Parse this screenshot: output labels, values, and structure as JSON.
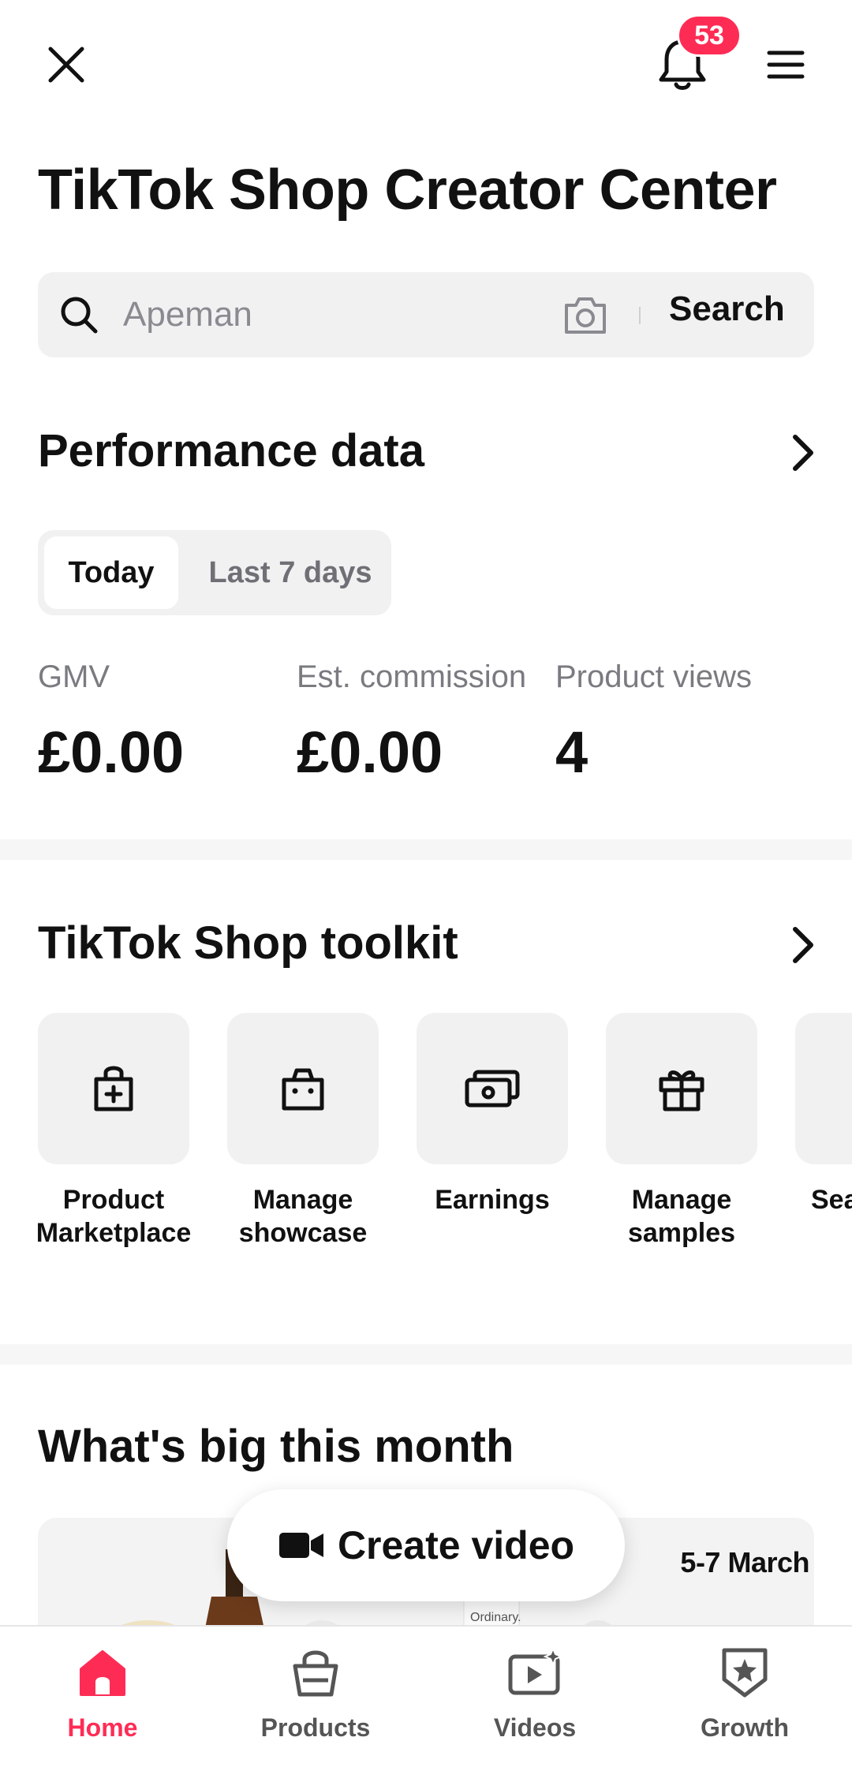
{
  "header": {
    "notification_count": "53",
    "close_icon": "close-icon",
    "bell_icon": "bell-icon",
    "menu_icon": "menu-icon"
  },
  "page_title": "TikTok Shop Creator Center",
  "search": {
    "placeholder": "Apeman",
    "value": "",
    "button_label": "Search"
  },
  "performance": {
    "title": "Performance data",
    "tabs": [
      {
        "label": "Today",
        "selected": true
      },
      {
        "label": "Last 7 days",
        "selected": false
      }
    ],
    "metrics": [
      {
        "label": "GMV",
        "value": "£0.00"
      },
      {
        "label": "Est. commission",
        "value": "£0.00"
      },
      {
        "label": "Product views",
        "value": "4"
      }
    ]
  },
  "toolkit": {
    "title": "TikTok Shop toolkit",
    "items": [
      {
        "label": "Product Marketplace",
        "icon": "bag-plus-icon"
      },
      {
        "label": "Manage showcase",
        "icon": "shopping-bag-icon"
      },
      {
        "label": "Earnings",
        "icon": "cash-icon"
      },
      {
        "label": "Manage samples",
        "icon": "gift-icon"
      },
      {
        "label": "Sea... in...",
        "icon": "partial-icon"
      }
    ]
  },
  "big_this_month": {
    "title": "What's big this month",
    "card_date": "5-7 March",
    "card_brand_text": "Ordinary."
  },
  "floating_action": {
    "label": "Create video",
    "icon": "video-camera-icon"
  },
  "bottom_nav": {
    "items": [
      {
        "label": "Home",
        "icon": "home-icon",
        "active": true
      },
      {
        "label": "Products",
        "icon": "basket-icon",
        "active": false
      },
      {
        "label": "Videos",
        "icon": "video-sparkle-icon",
        "active": false
      },
      {
        "label": "Growth",
        "icon": "star-shield-icon",
        "active": false
      }
    ]
  },
  "colors": {
    "accent": "#fe2c55",
    "card_bg": "#f1f1f2",
    "muted_text": "#7a7b80"
  }
}
